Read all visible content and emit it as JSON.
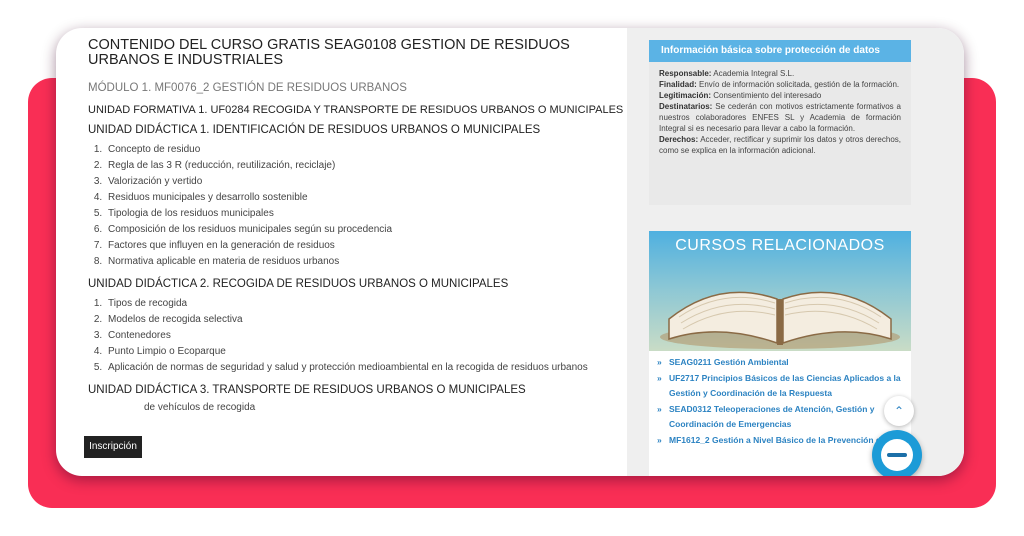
{
  "course": {
    "title": "CONTENIDO DEL CURSO GRATIS SEAG0108 GESTIÓN DE RESIDUOS URBANOS E INDUSTRIALES",
    "module": "MÓDULO 1. MF0076_2 GESTIÓN DE RESIDUOS URBANOS",
    "uf": "UNIDAD FORMATIVA 1. UF0284 RECOGIDA Y TRANSPORTE DE RESIDUOS URBANOS O MUNICIPALES",
    "units": [
      {
        "title": "UNIDAD DIDÁCTICA 1. IDENTIFICACIÓN DE RESIDUOS URBANOS O MUNICIPALES",
        "topics": [
          "Concepto de residuo",
          "Regla de las 3 R (reducción, reutilización, reciclaje)",
          "Valorización y vertido",
          "Residuos municipales y desarrollo sostenible",
          "Tipologia de los residuos municipales",
          "Composición de los residuos municipales según su procedencia",
          "Factores que influyen en la generación de residuos",
          "Normativa aplicable en materia de residuos urbanos"
        ]
      },
      {
        "title": "UNIDAD DIDÁCTICA 2. RECOGIDA DE RESIDUOS URBANOS O MUNICIPALES",
        "topics": [
          "Tipos de recogida",
          "Modelos de recogida selectiva",
          "Contenedores",
          "Punto Limpio o Ecoparque",
          "Aplicación de normas de seguridad y salud y protección medioambiental en la recogida de residuos urbanos"
        ]
      },
      {
        "title": "UNIDAD DIDÁCTICA 3. TRANSPORTE DE RESIDUOS URBANOS O MUNICIPALES",
        "topics": [
          "de vehículos de recogida"
        ]
      }
    ]
  },
  "inscripcion_label": "Inscripción",
  "privacy": {
    "header": "Información básica sobre protección de datos",
    "rows": [
      {
        "label": "Responsable:",
        "text": "Academia Integral S.L."
      },
      {
        "label": "Finalidad:",
        "text": "Envío de información solicitada, gestión de la formación."
      },
      {
        "label": "Legitimación:",
        "text": "Consentimiento del interesado"
      },
      {
        "label": "Destinatarios:",
        "text": "Se cederán con motivos estrictamente formativos a nuestros colaboradores ENFES SL y Academia de formación Integral si es necesario para llevar a cabo la formación."
      },
      {
        "label": "Derechos:",
        "text": "Acceder, rectificar y suprimir los datos y otros derechos, como se explica en la información adicional."
      }
    ]
  },
  "related": {
    "title": "CURSOS RELACIONADOS",
    "items": [
      "SEAG0211 Gestión Ambiental",
      "UF2717 Principios Básicos de las Ciencias Aplicados a la Gestión y Coordinación de la Respuesta",
      "SEAD0312 Teleoperaciones de Atención, Gestión y Coordinación de Emergencias",
      "MF1612_2 Gestión a Nivel Básico de la Prevención de"
    ]
  },
  "colors": {
    "accent_pink": "#f92e55",
    "header_blue": "#5bb3e5",
    "link_blue": "#2c83c2",
    "chat_blue": "#1c9bd7"
  },
  "icons": {
    "scroll_top": "chevron-up-icon",
    "chat": "chat-icon",
    "book": "open-book-image"
  }
}
